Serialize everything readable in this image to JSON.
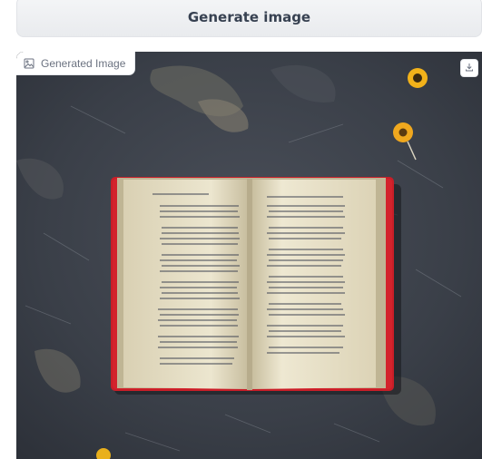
{
  "generate_button": {
    "label": "Generate image"
  },
  "output": {
    "label": "Generated Image",
    "label_icon": "image-icon",
    "download_icon": "download-icon"
  },
  "colors": {
    "button_bg": "#eceef1",
    "button_text": "#374151",
    "label_text": "#6b7280",
    "book_cover": "#d3232c",
    "page_paper": "#e9e3cc",
    "background_stone": "#3b4049",
    "flower": "#f2b21a"
  }
}
